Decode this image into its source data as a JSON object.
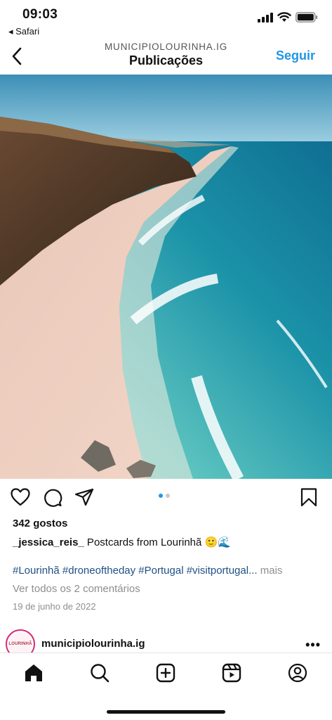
{
  "status_bar": {
    "time": "09:03",
    "back_app": "◂ Safari"
  },
  "header": {
    "account": "MUNICIPIOLOURINHA.IG",
    "title": "Publicações",
    "follow_label": "Seguir"
  },
  "post": {
    "carousel": {
      "count": 2,
      "active": 1
    },
    "likes": "342 gostos",
    "caption": {
      "user": "_jessica_reis_",
      "text": " Postcards from Lourinhã 🙂🌊"
    },
    "hashtags": "#Lourinhã #droneoftheday #Portugal #visitportugal...",
    "more_label": " mais",
    "comments": "Ver todos os 2 comentários",
    "date": "19 de junho de 2022"
  },
  "next_post": {
    "username": "municipiolourinha.ig",
    "avatar_text": "LOURINHÃ",
    "more": "•••"
  },
  "icons": {
    "back": "chevron-left-icon",
    "like": "heart-icon",
    "comment": "comment-icon",
    "share": "paper-plane-icon",
    "save": "bookmark-icon",
    "tabs": [
      "home-icon",
      "search-icon",
      "create-icon",
      "reels-icon",
      "profile-icon"
    ]
  },
  "colors": {
    "accent": "#2196e6",
    "hashtag": "#1f4f84",
    "muted": "#8e8e8e"
  }
}
